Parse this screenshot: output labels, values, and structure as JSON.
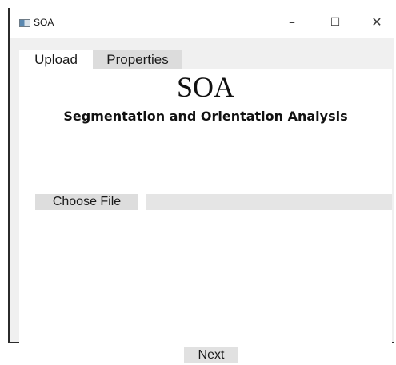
{
  "window": {
    "title": "SOA",
    "controls": {
      "minimize": "–",
      "maximize": "☐",
      "close": "✕"
    }
  },
  "tabs": [
    {
      "label": "Upload",
      "active": true
    },
    {
      "label": "Properties",
      "active": false
    }
  ],
  "upload": {
    "heading": "SOA",
    "subheading": "Segmentation and Orientation Analysis",
    "choose_file_label": "Choose File",
    "file_path_value": "",
    "next_label": "Next"
  }
}
